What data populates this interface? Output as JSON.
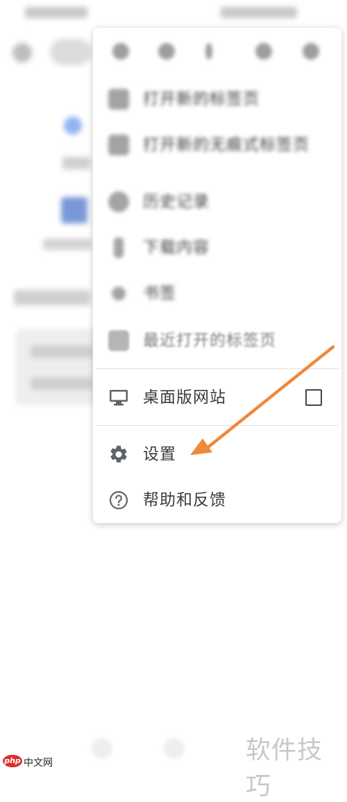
{
  "menu": {
    "items": [
      {
        "label": "打开新的标签页",
        "icon": "new-tab-icon",
        "blurred": true
      },
      {
        "label": "打开新的无痕式标签页",
        "icon": "incognito-icon",
        "blurred": true
      },
      {
        "label": "历史记录",
        "icon": "history-icon",
        "blurred": true
      },
      {
        "label": "下载内容",
        "icon": "download-icon",
        "blurred": true
      },
      {
        "label": "书签",
        "icon": "bookmark-star-icon",
        "blurred": true
      },
      {
        "label": "最近打开的标签页",
        "icon": "recent-tabs-icon",
        "blurred": true
      },
      {
        "label": "桌面版网站",
        "icon": "desktop-monitor-icon",
        "checked": false
      },
      {
        "label": "设置",
        "icon": "gear-icon"
      },
      {
        "label": "帮助和反馈",
        "icon": "help-circle-icon"
      }
    ]
  },
  "annotation": {
    "arrow_color": "#f0883a",
    "target": "设置"
  },
  "watermark": {
    "text": "软件技巧"
  },
  "footer_logo": {
    "badge": "php",
    "text": "中文网"
  }
}
